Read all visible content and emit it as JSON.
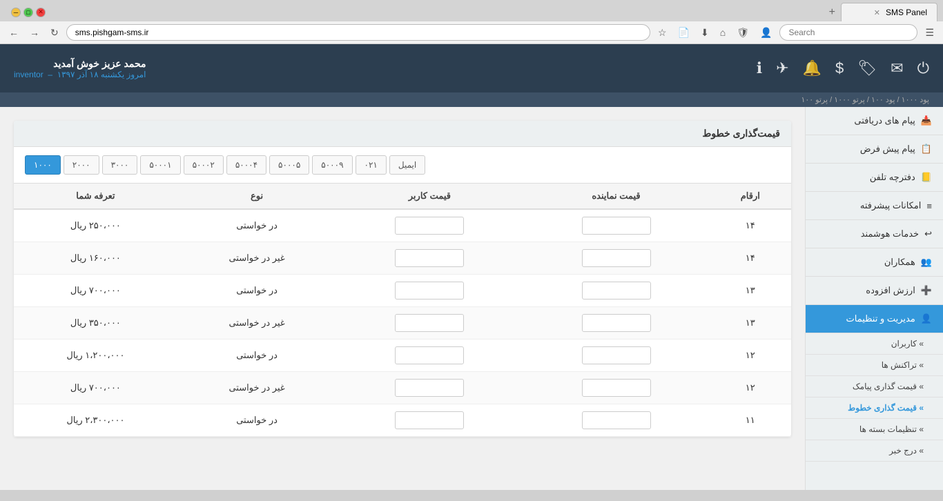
{
  "browser": {
    "tab_title": "SMS Panel",
    "url": "sms.pishgam-sms.ir",
    "search_placeholder": "Search"
  },
  "header": {
    "user_name": "محمد عزیز خوش آمدید",
    "username": "inventor",
    "date_label": "امروز یکشنبه ۱۸ آذر ۱۳۹۷",
    "info_bar": "پود ۱۰۰۰ / پود ۱۰۰ / پرتو ۱۰۰۰ / پرتو ۱۰۰"
  },
  "sidebar": {
    "items": [
      {
        "id": "received",
        "label": "پیام های دریافتی",
        "icon": "📥"
      },
      {
        "id": "draft",
        "label": "پیام پیش فرض",
        "icon": "📋"
      },
      {
        "id": "phonebook",
        "label": "دفترچه تلفن",
        "icon": "📒"
      },
      {
        "id": "advanced",
        "label": "امکانات پیشرفته",
        "icon": "≡"
      },
      {
        "id": "smart",
        "label": "خدمات هوشمند",
        "icon": "↩"
      },
      {
        "id": "partners",
        "label": "همکاران",
        "icon": "👥"
      },
      {
        "id": "value_added",
        "label": "ارزش افزوده",
        "icon": "➕"
      },
      {
        "id": "management",
        "label": "مدیریت و تنظیمات",
        "icon": "👤",
        "active": true
      }
    ],
    "sub_items": [
      {
        "id": "users",
        "label": "کاربران"
      },
      {
        "id": "transactions",
        "label": "تراکنش ها"
      },
      {
        "id": "sms_pricing",
        "label": "قیمت گذاری پیامک"
      },
      {
        "id": "line_pricing",
        "label": "قیمت گذاری خطوط",
        "active": true
      },
      {
        "id": "bundle_settings",
        "label": "تنظیمات بسته ها"
      },
      {
        "id": "news",
        "label": "درج خبر"
      }
    ]
  },
  "page_title": "قیمت‌گذاری خطوط",
  "tabs": [
    {
      "id": "1000",
      "label": "۱۰۰۰",
      "active": true
    },
    {
      "id": "2000",
      "label": "۲۰۰۰"
    },
    {
      "id": "3000",
      "label": "۳۰۰۰"
    },
    {
      "id": "50001",
      "label": "۵۰۰۰۱"
    },
    {
      "id": "50002",
      "label": "۵۰۰۰۲"
    },
    {
      "id": "50004",
      "label": "۵۰۰۰۴"
    },
    {
      "id": "50005",
      "label": "۵۰۰۰۵"
    },
    {
      "id": "50009",
      "label": "۵۰۰۰۹"
    },
    {
      "id": "021",
      "label": "۰۲۱"
    },
    {
      "id": "email",
      "label": "ایمیل"
    }
  ],
  "table": {
    "columns": {
      "number": "ارقام",
      "agent_price": "قیمت نماینده",
      "user_price": "قیمت کاربر",
      "type": "نوع",
      "your_tariff": "تعرفه شما"
    },
    "rows": [
      {
        "number": "۱۴",
        "agent_price": "",
        "user_price": "",
        "type": "در خواستی",
        "tariff": "۲۵۰،۰۰۰ ریال"
      },
      {
        "number": "۱۴",
        "agent_price": "",
        "user_price": "",
        "type": "غیر در خواستی",
        "tariff": "۱۶۰،۰۰۰ ریال"
      },
      {
        "number": "۱۳",
        "agent_price": "",
        "user_price": "",
        "type": "در خواستی",
        "tariff": "۷۰۰،۰۰۰ ریال"
      },
      {
        "number": "۱۳",
        "agent_price": "",
        "user_price": "",
        "type": "غیر در خواستی",
        "tariff": "۳۵۰،۰۰۰ ریال"
      },
      {
        "number": "۱۲",
        "agent_price": "",
        "user_price": "",
        "type": "در خواستی",
        "tariff": "۱،۲۰۰،۰۰۰ ریال"
      },
      {
        "number": "۱۲",
        "agent_price": "",
        "user_price": "",
        "type": "غیر در خواستی",
        "tariff": "۷۰۰،۰۰۰ ریال"
      },
      {
        "number": "۱۱",
        "agent_price": "",
        "user_price": "",
        "type": "در خواستی",
        "tariff": "۲،۳۰۰،۰۰۰ ریال"
      }
    ]
  }
}
